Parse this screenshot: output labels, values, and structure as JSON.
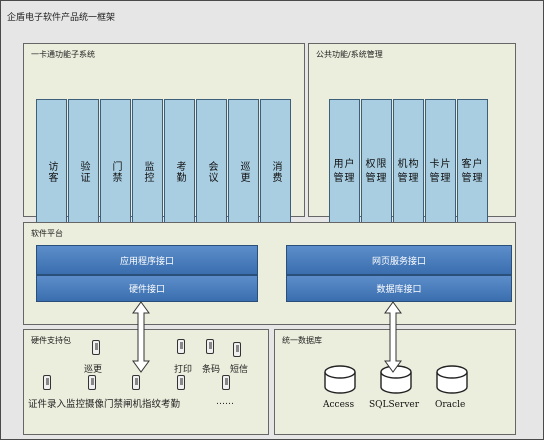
{
  "title": "企盾电子软件产品统一框架",
  "one_card": {
    "title": "一卡通功能子系统",
    "modules": [
      "访客",
      "验证",
      "门禁",
      "监控",
      "考勤",
      "会议",
      "巡更",
      "消费"
    ]
  },
  "public": {
    "title": "公共功能/系统管理",
    "modules": [
      "用户管理",
      "权限管理",
      "机构管理",
      "卡片管理",
      "客户管理"
    ]
  },
  "platform": {
    "title": "软件平台",
    "app_api": "应用程序接口",
    "hw_api": "硬件接口",
    "web_api": "网页服务接口",
    "db_api": "数据库接口"
  },
  "hardware": {
    "title": "硬件支持包",
    "row1": {
      "patrol": "巡更",
      "print": "打印",
      "barcode": "条码",
      "sms": "短信"
    },
    "row2": "证件录入监控摄像门禁闸机指纹考勤",
    "more": "……"
  },
  "database": {
    "title": "统一数据库",
    "items": [
      "Access",
      "SQLServer",
      "Oracle"
    ]
  }
}
